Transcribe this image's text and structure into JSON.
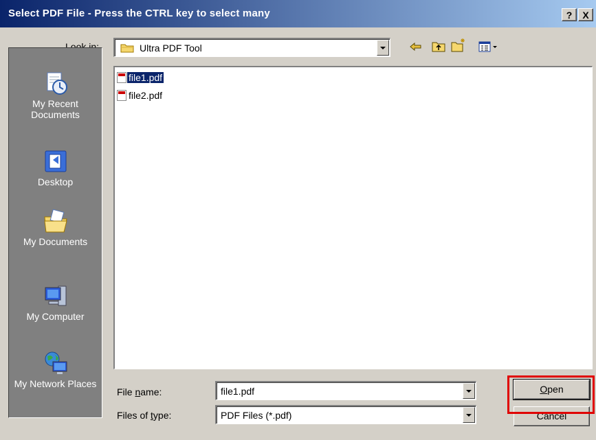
{
  "window": {
    "title": "Select PDF File - Press the CTRL key to select many"
  },
  "titlebar_buttons": {
    "help": "?",
    "close": "X"
  },
  "lookin": {
    "label_prefix": "Look ",
    "label_accel": "i",
    "label_suffix": "n:",
    "value": "Ultra PDF Tool"
  },
  "places": [
    {
      "label": "My Recent Documents",
      "icon": "recent-documents-icon"
    },
    {
      "label": "Desktop",
      "icon": "desktop-icon"
    },
    {
      "label": "My Documents",
      "icon": "my-documents-icon"
    },
    {
      "label": "My Computer",
      "icon": "my-computer-icon"
    },
    {
      "label": "My Network Places",
      "icon": "network-places-icon"
    }
  ],
  "files": [
    {
      "name": "file1.pdf",
      "selected": true
    },
    {
      "name": "file2.pdf",
      "selected": false
    }
  ],
  "filename": {
    "label_prefix": "File ",
    "label_accel": "n",
    "label_suffix": "ame:",
    "value": "file1.pdf"
  },
  "filetype": {
    "label_prefix": "Files of ",
    "label_accel": "t",
    "label_suffix": "ype:",
    "value": "PDF Files (*.pdf)"
  },
  "buttons": {
    "open_accel": "O",
    "open_rest": "pen",
    "cancel": "Cancel"
  },
  "colors": {
    "title_start": "#0a246a",
    "title_end": "#a6caf0",
    "highlight_box": "#e00000",
    "selection": "#0a246a"
  }
}
